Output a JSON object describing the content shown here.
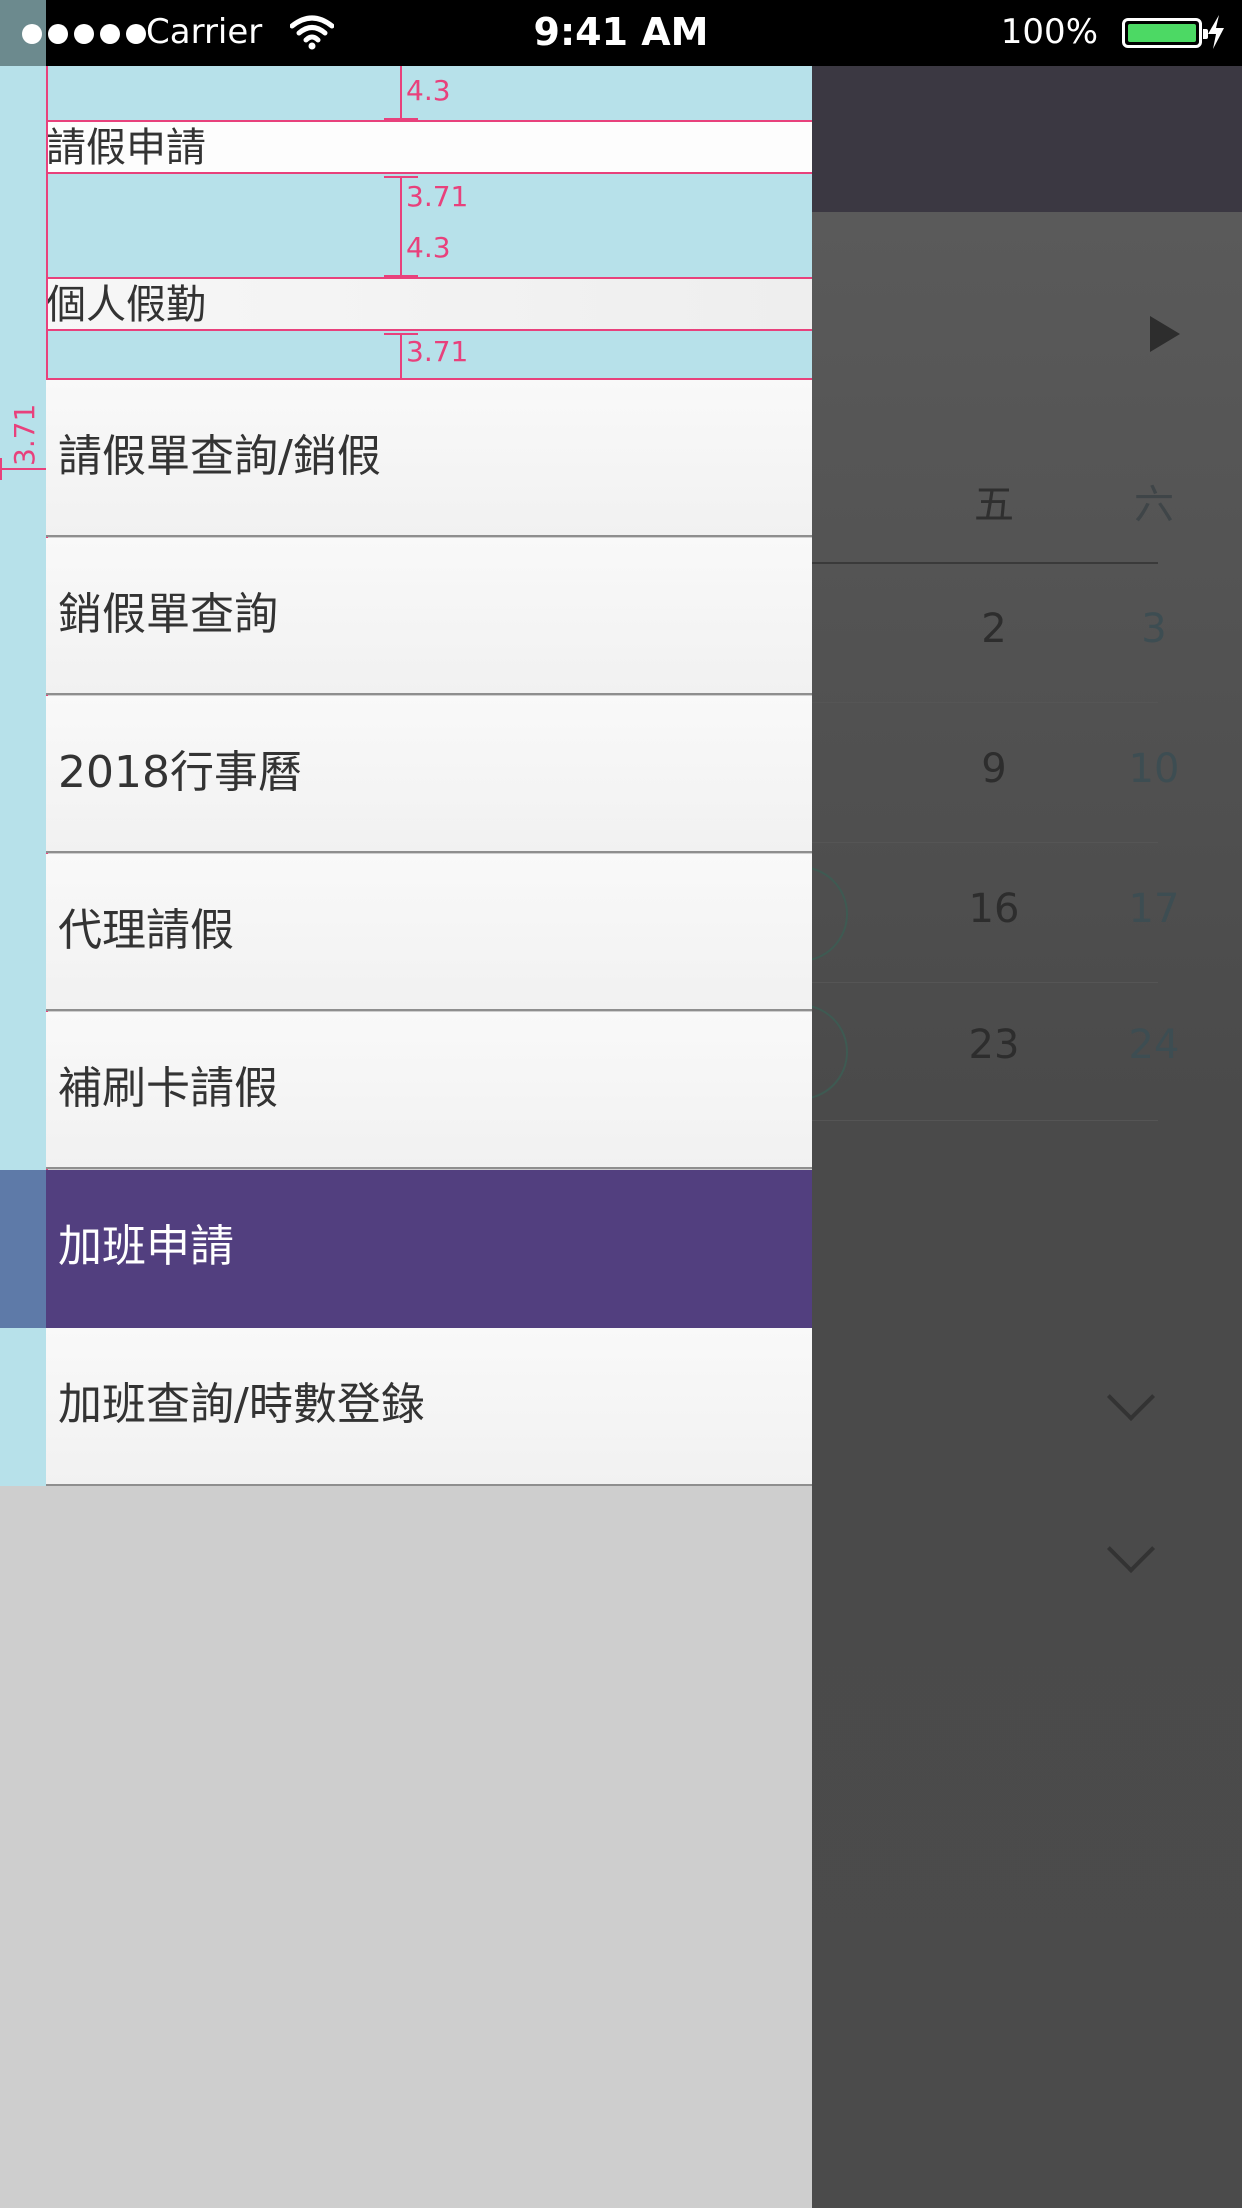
{
  "status_bar": {
    "carrier": "Carrier",
    "time": "9:41 AM",
    "battery_percent": "100%",
    "battery_color": "#4cd964",
    "icons": [
      "signal-dots-icon",
      "wifi-icon",
      "battery-icon",
      "charging-bolt-icon"
    ]
  },
  "drawer": {
    "sections": [
      {
        "title": "請假申請",
        "spacing_top": "4.3",
        "spacing_bottom": "3.71"
      },
      {
        "title": "個人假勤",
        "spacing_top": "4.3",
        "spacing_bottom": "3.71"
      }
    ],
    "side_spacing": "3.71",
    "items": [
      {
        "label": "請假單查詢/銷假",
        "active": false
      },
      {
        "label": "銷假單查詢",
        "active": false
      },
      {
        "label": "2018行事曆",
        "active": false
      },
      {
        "label": "代理請假",
        "active": false
      },
      {
        "label": "補刷卡請假",
        "active": false
      },
      {
        "label": "加班申請",
        "active": true
      },
      {
        "label": "加班查詢/時數登錄",
        "active": false
      }
    ],
    "active_color": "#523f7f",
    "annotation_color": "#e8417c"
  },
  "background_calendar": {
    "weekday_headers": [
      "五",
      "六"
    ],
    "rows": [
      [
        "2",
        "3"
      ],
      [
        "9",
        "10"
      ],
      [
        "16",
        "17"
      ],
      [
        "23",
        "24"
      ]
    ]
  }
}
